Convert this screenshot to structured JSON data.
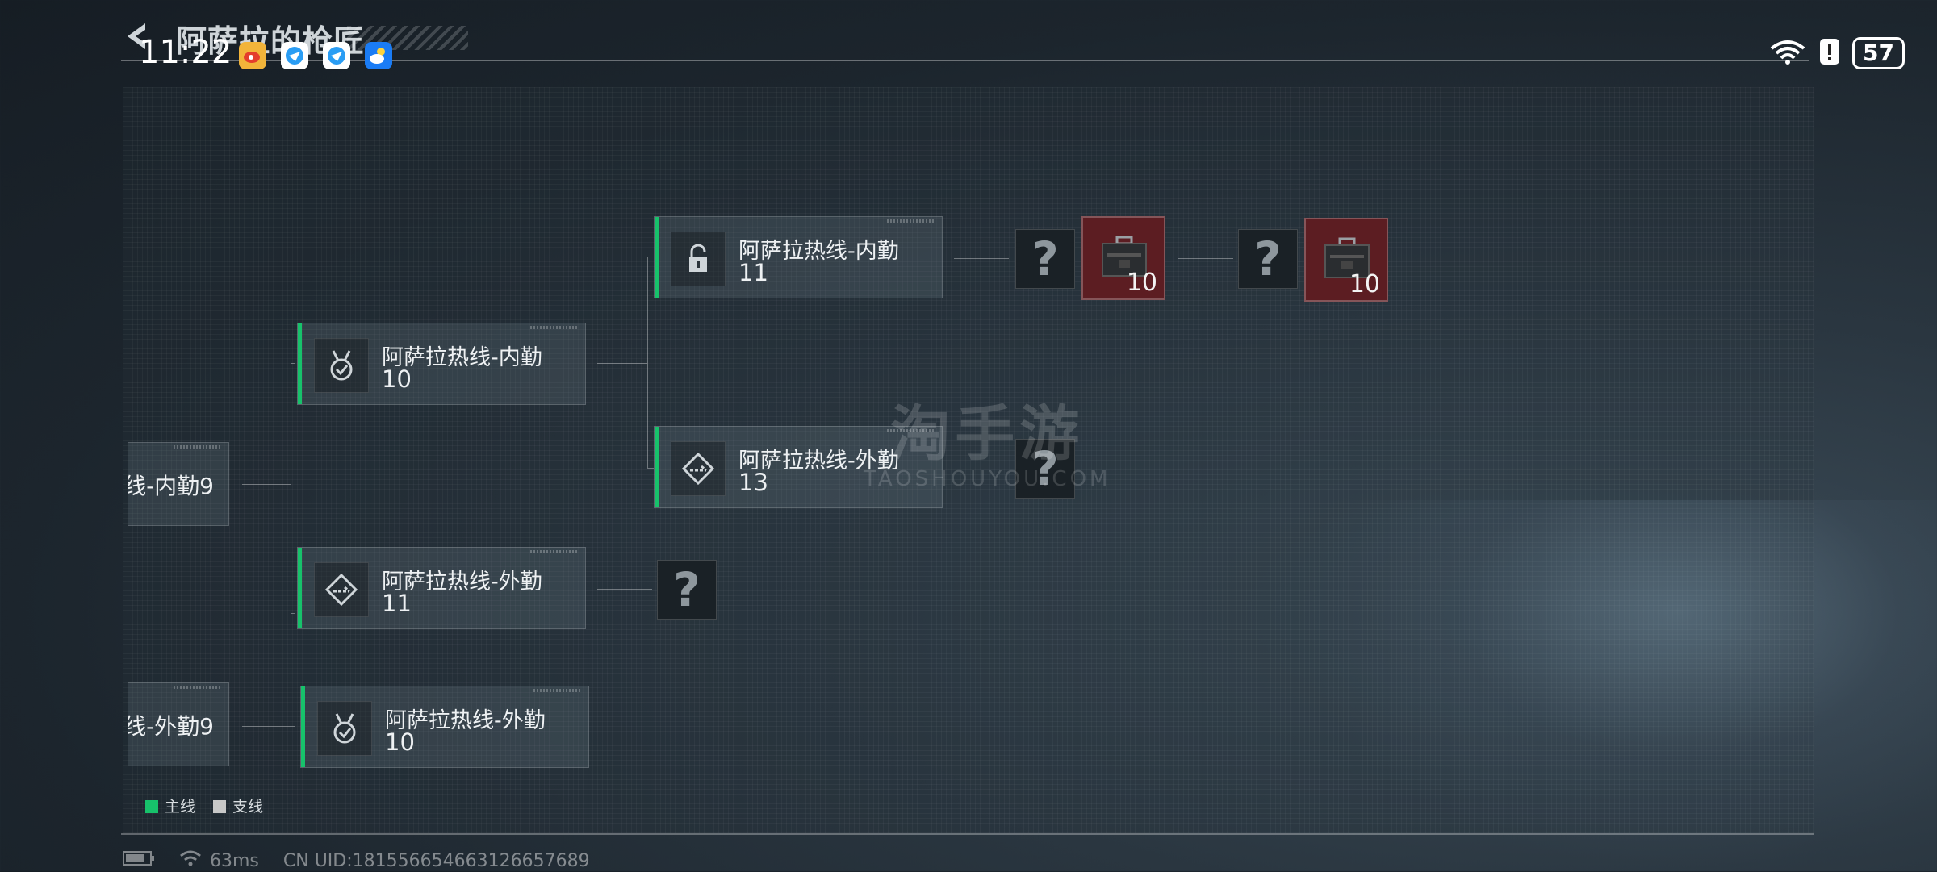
{
  "status_bar": {
    "time": "11:22",
    "battery": "57",
    "notification_icons": [
      "weibo-icon",
      "app-icon",
      "app-icon",
      "weather-icon"
    ]
  },
  "header": {
    "title": "阿萨拉的枪匠"
  },
  "tree": {
    "partial_nodes": [
      {
        "name": "线-内勤9"
      },
      {
        "name": "线-外勤9"
      }
    ],
    "nodes": [
      {
        "name": "阿萨拉热线-内勤",
        "level": "10",
        "icon": "medal-icon",
        "status": "main"
      },
      {
        "name": "阿萨拉热线-外勤",
        "level": "11",
        "icon": "diamond-arrow-icon",
        "status": "main"
      },
      {
        "name": "阿萨拉热线-外勤",
        "level": "10",
        "icon": "medal-icon",
        "status": "main"
      },
      {
        "name": "阿萨拉热线-内勤",
        "level": "11",
        "icon": "lock-icon",
        "status": "main"
      },
      {
        "name": "阿萨拉热线-外勤",
        "level": "13",
        "icon": "diamond-arrow-icon",
        "status": "main"
      }
    ],
    "unknown_marks": [
      "?",
      "?",
      "?",
      "?"
    ],
    "rewards": [
      {
        "count": "10",
        "icon": "weapon-case-icon"
      },
      {
        "count": "10",
        "icon": "weapon-case-icon"
      }
    ]
  },
  "legend": {
    "main": {
      "label": "主线",
      "color": "#17c26b"
    },
    "side": {
      "label": "支线",
      "color": "#c8c8c8"
    }
  },
  "watermark": {
    "text": "淘手游",
    "sub": "TAOSHOUYOU.COM"
  },
  "footer": {
    "ping": "63ms",
    "uid": "CN UID:1815566546631266576​89"
  }
}
